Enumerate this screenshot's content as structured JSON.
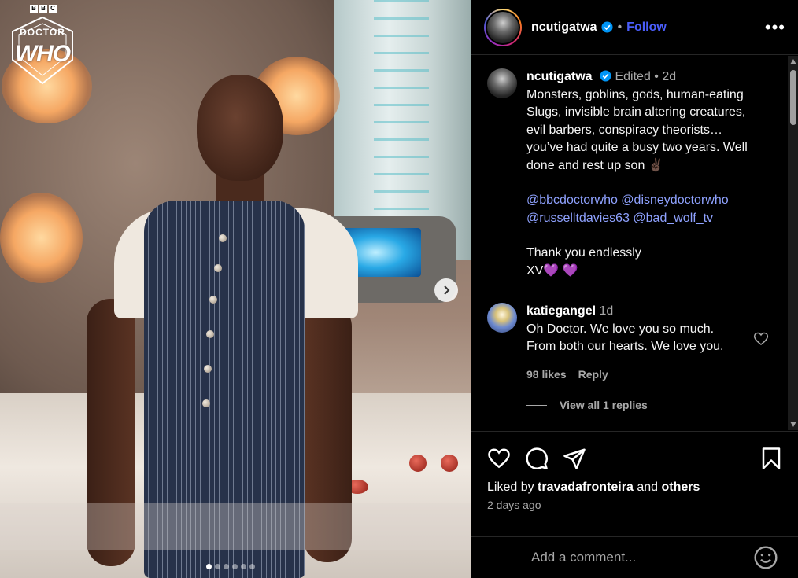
{
  "media": {
    "logo": {
      "brand": "BBC",
      "line1": "DOCTOR",
      "line2": "WHO"
    },
    "carousel": {
      "slides": 6,
      "active_index": 0
    },
    "next_icon": "chevron-right-icon"
  },
  "post": {
    "author": "ncutigatwa",
    "verified": true,
    "follow_label": "Follow",
    "more_icon": "more-horizontal-icon",
    "edited_label": "Edited",
    "age": "2d",
    "caption_lines": [
      "Monsters, goblins, gods, human-eating",
      "Slugs, invisible brain altering creatures,",
      "evil barbers, conspiracy theorists…",
      "you’ve had quite a busy two years. Well",
      "done and rest up son ✌🏿"
    ],
    "mentions_line1": "@bbcdoctorwho @disneydoctorwho",
    "mentions_line2": "@russelltdavies63 @bad_wolf_tv",
    "closing_line1": "Thank you endlessly",
    "closing_line2": "XV💜 💜"
  },
  "comment": {
    "user": "katiegangel",
    "age": "1d",
    "text_line1": "Oh Doctor. We love you so much.",
    "text_line2": "From both our hearts. We love you.",
    "likes": "98 likes",
    "reply_label": "Reply",
    "view_replies": "View all 1 replies"
  },
  "actions": {
    "liked_prefix": "Liked by",
    "liked_user": "travadafronteira",
    "liked_and": "and",
    "liked_others": "others",
    "timestamp": "2 days ago"
  },
  "composer": {
    "placeholder": "Add a comment...",
    "emoji_icon": "smiley-icon"
  },
  "colors": {
    "background": "#000000",
    "text": "#f5f5f5",
    "muted": "#a8a8a8",
    "follow": "#4a5df9",
    "mention": "#8fa2ff",
    "verified": "#0095f6"
  }
}
